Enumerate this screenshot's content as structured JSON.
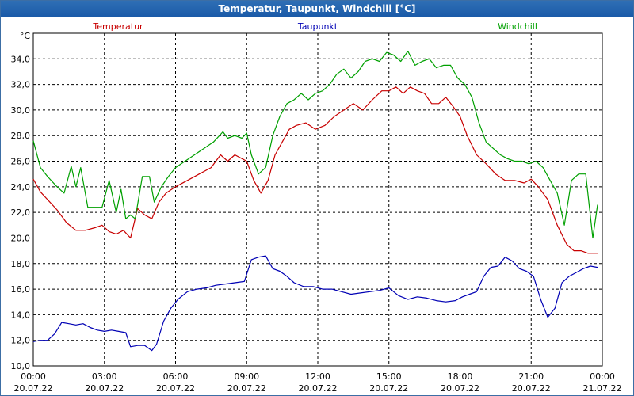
{
  "window": {
    "title": "Temperatur, Taupunkt, Windchill [°C]"
  },
  "colors": {
    "titlebar": "#1a5aa8",
    "temperatur": "#c80000",
    "taupunkt": "#0000b4",
    "windchill": "#00a000"
  },
  "chart_data": {
    "type": "line",
    "title": "Temperatur, Taupunkt, Windchill [°C]",
    "ylabel": "°C",
    "xlabel": "",
    "ylim": [
      10,
      36
    ],
    "y_ticks": [
      "10,0",
      "12,0",
      "14,0",
      "16,0",
      "18,0",
      "20,0",
      "22,0",
      "24,0",
      "26,0",
      "28,0",
      "30,0",
      "32,0",
      "34,0"
    ],
    "xlim": [
      0,
      24
    ],
    "x_ticks": [
      {
        "time": "00:00",
        "date": "20.07.22"
      },
      {
        "time": "03:00",
        "date": "20.07.22"
      },
      {
        "time": "06:00",
        "date": "20.07.22"
      },
      {
        "time": "09:00",
        "date": "20.07.22"
      },
      {
        "time": "12:00",
        "date": "20.07.22"
      },
      {
        "time": "15:00",
        "date": "20.07.22"
      },
      {
        "time": "18:00",
        "date": "20.07.22"
      },
      {
        "time": "21:00",
        "date": "20.07.22"
      },
      {
        "time": "00:00",
        "date": "21.07.22"
      }
    ],
    "grid": true,
    "legend": "top",
    "series": [
      {
        "name": "Temperatur",
        "color": "#c80000",
        "x": [
          0,
          0.3,
          0.6,
          1.0,
          1.4,
          1.8,
          2.2,
          2.6,
          2.9,
          3.2,
          3.5,
          3.8,
          4.1,
          4.4,
          4.7,
          5.0,
          5.3,
          5.6,
          6.0,
          6.5,
          7.0,
          7.5,
          7.9,
          8.2,
          8.5,
          8.8,
          9.0,
          9.3,
          9.6,
          9.9,
          10.2,
          10.5,
          10.8,
          11.1,
          11.5,
          11.9,
          12.3,
          12.7,
          13.1,
          13.5,
          13.9,
          14.3,
          14.7,
          15.0,
          15.3,
          15.6,
          15.9,
          16.2,
          16.5,
          16.8,
          17.1,
          17.4,
          17.7,
          18.0,
          18.3,
          18.7,
          19.1,
          19.5,
          19.9,
          20.3,
          20.7,
          21.0,
          21.3,
          21.7,
          22.1,
          22.5,
          22.8,
          23.1,
          23.4,
          23.8
        ],
        "values": [
          24.6,
          23.6,
          23.0,
          22.2,
          21.2,
          20.6,
          20.6,
          20.8,
          21.0,
          20.5,
          20.3,
          20.6,
          20.0,
          22.3,
          21.8,
          21.5,
          22.8,
          23.5,
          24.0,
          24.5,
          25.0,
          25.5,
          26.5,
          26.0,
          26.5,
          26.2,
          26.0,
          24.5,
          23.5,
          24.5,
          26.5,
          27.5,
          28.5,
          28.8,
          29.0,
          28.5,
          28.8,
          29.5,
          30.0,
          30.5,
          30.0,
          30.8,
          31.5,
          31.5,
          31.8,
          31.3,
          31.8,
          31.5,
          31.3,
          30.5,
          30.5,
          31.0,
          30.3,
          29.5,
          28.0,
          26.5,
          25.8,
          25.0,
          24.5,
          24.5,
          24.3,
          24.6,
          24.0,
          23.0,
          21.0,
          19.5,
          19.0,
          19.0,
          18.8,
          18.8
        ]
      },
      {
        "name": "Taupunkt",
        "color": "#0000b4",
        "x": [
          0,
          0.3,
          0.6,
          0.9,
          1.2,
          1.5,
          1.8,
          2.1,
          2.4,
          2.7,
          3.0,
          3.3,
          3.6,
          3.9,
          4.1,
          4.4,
          4.7,
          5.0,
          5.2,
          5.5,
          5.8,
          6.1,
          6.5,
          6.9,
          7.3,
          7.7,
          8.1,
          8.5,
          8.9,
          9.2,
          9.5,
          9.8,
          10.1,
          10.4,
          10.7,
          11.0,
          11.4,
          11.8,
          12.2,
          12.6,
          13.0,
          13.4,
          13.8,
          14.2,
          14.6,
          15.0,
          15.4,
          15.8,
          16.2,
          16.6,
          17.0,
          17.4,
          17.8,
          18.1,
          18.4,
          18.7,
          19.0,
          19.3,
          19.6,
          19.9,
          20.2,
          20.5,
          20.8,
          21.1,
          21.4,
          21.7,
          22.0,
          22.3,
          22.6,
          22.9,
          23.2,
          23.5,
          23.8
        ],
        "values": [
          11.9,
          12.0,
          12.0,
          12.5,
          13.4,
          13.3,
          13.2,
          13.3,
          13.0,
          12.8,
          12.7,
          12.8,
          12.7,
          12.6,
          11.5,
          11.6,
          11.6,
          11.2,
          11.7,
          13.5,
          14.5,
          15.2,
          15.8,
          16.0,
          16.1,
          16.3,
          16.4,
          16.5,
          16.6,
          18.3,
          18.5,
          18.6,
          17.6,
          17.4,
          17.0,
          16.5,
          16.2,
          16.2,
          16.0,
          16.0,
          15.8,
          15.6,
          15.7,
          15.8,
          15.9,
          16.1,
          15.5,
          15.2,
          15.4,
          15.3,
          15.1,
          15.0,
          15.1,
          15.4,
          15.6,
          15.8,
          17.0,
          17.7,
          17.8,
          18.5,
          18.2,
          17.6,
          17.4,
          17.0,
          15.2,
          13.8,
          14.5,
          16.5,
          17.0,
          17.3,
          17.6,
          17.8,
          17.7
        ]
      },
      {
        "name": "Windchill",
        "color": "#00a000",
        "x": [
          0,
          0.3,
          0.6,
          1.0,
          1.3,
          1.6,
          1.8,
          2.0,
          2.3,
          2.6,
          2.9,
          3.2,
          3.5,
          3.7,
          3.9,
          4.1,
          4.3,
          4.6,
          4.9,
          5.1,
          5.4,
          5.7,
          6.0,
          6.4,
          6.8,
          7.2,
          7.6,
          8.0,
          8.2,
          8.5,
          8.8,
          9.0,
          9.2,
          9.5,
          9.8,
          10.1,
          10.4,
          10.7,
          11.0,
          11.3,
          11.6,
          11.9,
          12.2,
          12.5,
          12.8,
          13.1,
          13.4,
          13.7,
          14.0,
          14.3,
          14.6,
          14.9,
          15.2,
          15.5,
          15.8,
          16.1,
          16.4,
          16.7,
          17.0,
          17.3,
          17.6,
          17.9,
          18.2,
          18.5,
          18.8,
          19.1,
          19.4,
          19.7,
          20.0,
          20.3,
          20.6,
          20.9,
          21.2,
          21.5,
          21.8,
          22.1,
          22.4,
          22.7,
          23.0,
          23.3,
          23.6,
          23.8
        ],
        "values": [
          27.6,
          25.5,
          24.8,
          24.0,
          23.5,
          25.6,
          24.0,
          25.5,
          22.4,
          22.4,
          22.4,
          24.5,
          22.0,
          23.8,
          21.5,
          21.8,
          21.5,
          24.8,
          24.8,
          22.8,
          24.0,
          24.8,
          25.5,
          26.0,
          26.5,
          27.0,
          27.5,
          28.3,
          27.8,
          28.0,
          27.8,
          28.2,
          26.5,
          25.0,
          25.5,
          28.0,
          29.5,
          30.5,
          30.8,
          31.3,
          30.8,
          31.3,
          31.5,
          32.0,
          32.8,
          33.2,
          32.5,
          33.0,
          33.8,
          34.0,
          33.8,
          34.5,
          34.3,
          33.8,
          34.6,
          33.5,
          33.8,
          34.0,
          33.3,
          33.5,
          33.5,
          32.5,
          32.0,
          31.0,
          29.0,
          27.5,
          27.0,
          26.5,
          26.2,
          26.0,
          26.0,
          25.8,
          26.0,
          25.5,
          24.5,
          23.5,
          21.0,
          24.5,
          25.0,
          25.0,
          20.0,
          22.6
        ]
      }
    ]
  }
}
